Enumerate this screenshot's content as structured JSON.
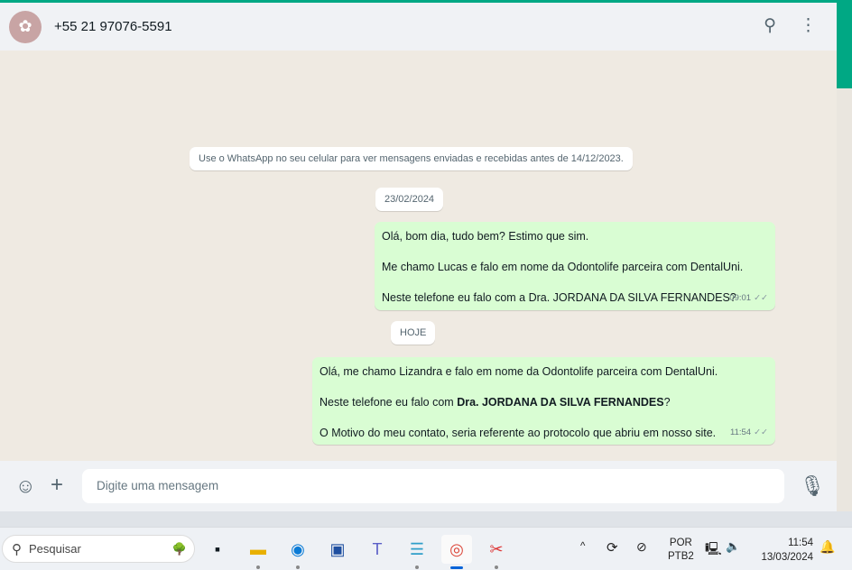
{
  "header": {
    "contact": "+55 21 97076-5591",
    "avatar_icon": "butterfly-icon"
  },
  "chat": {
    "system_notice": "Use o WhatsApp no seu celular para ver mensagens enviadas e recebidas antes de 14/12/2023.",
    "date1": "23/02/2024",
    "msg1": {
      "lines": [
        "Olá, bom dia, tudo bem? Estimo que sim.",
        "Me chamo Lucas e falo em nome da Odontolife parceira com DentalUni.",
        "Neste telefone eu falo com a Dra. JORDANA DA SILVA FERNANDES?"
      ],
      "time": "09:01"
    },
    "date2": "HOJE",
    "msg2": {
      "line1": "Olá, me chamo Lizandra e falo em nome da Odontolife parceira com DentalUni.",
      "line2_pre": "Neste telefone eu falo com ",
      "line2_bold": "Dra. JORDANA DA SILVA FERNANDES",
      "line2_post": "?",
      "line3": "O Motivo do meu contato, seria referente ao protocolo que abriu em nosso site.",
      "time": "11:54"
    }
  },
  "compose": {
    "placeholder": "Digite uma mensagem"
  },
  "taskbar": {
    "search": "Pesquisar",
    "lang1": "POR",
    "lang2": "PTB2",
    "time": "11:54",
    "date": "13/03/2024"
  }
}
